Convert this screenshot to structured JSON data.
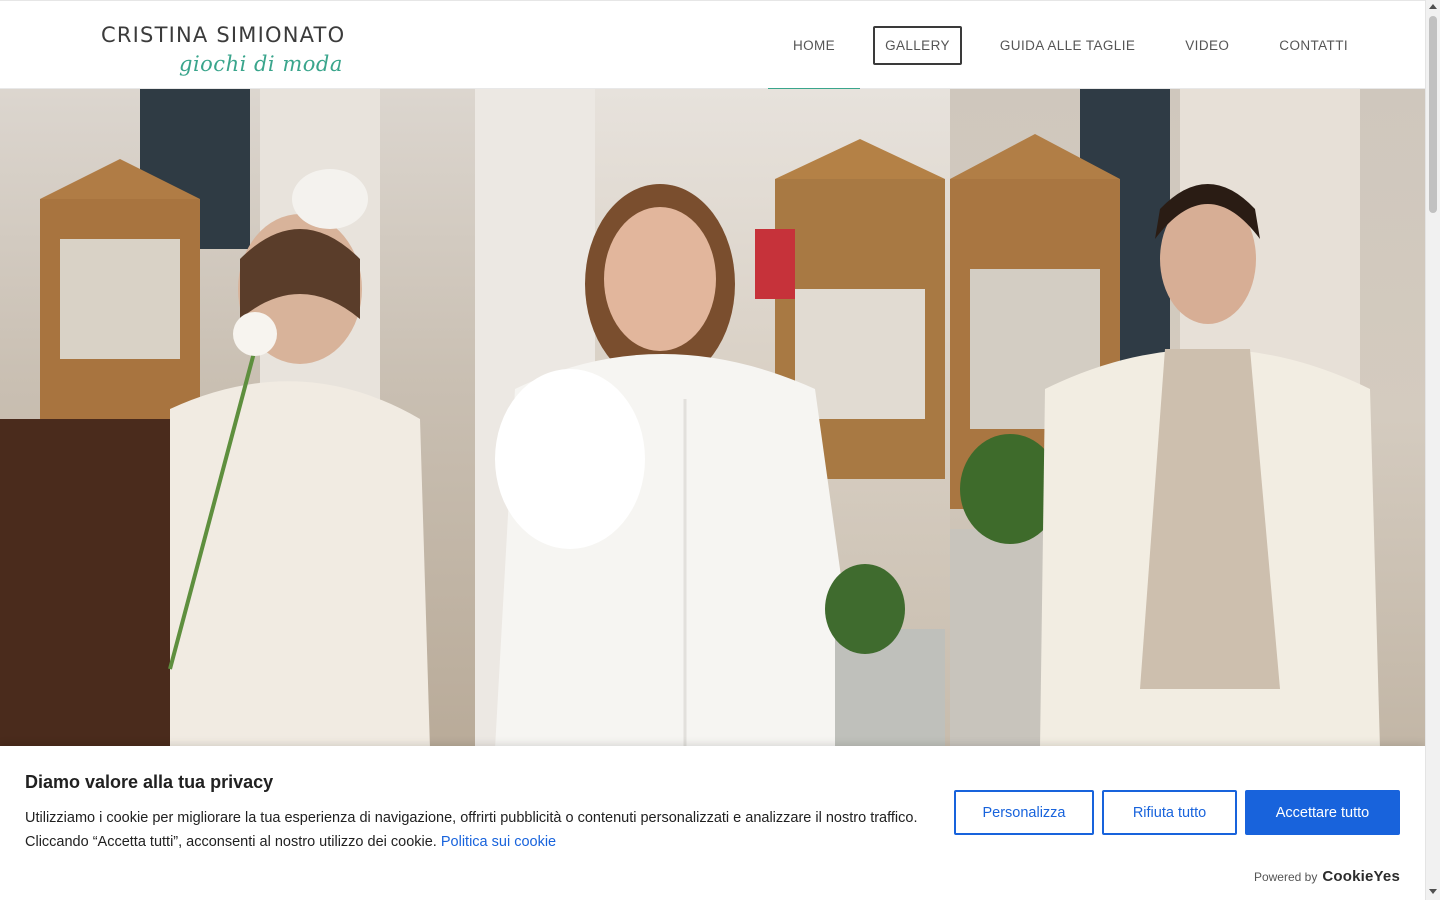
{
  "header": {
    "logo_main": "CRISTINA SIMIONATO",
    "logo_sub": "giochi di moda",
    "nav": [
      {
        "label": "HOME"
      },
      {
        "label": "GALLERY"
      },
      {
        "label": "GUIDA ALLE TAGLIE"
      },
      {
        "label": "VIDEO"
      },
      {
        "label": "CONTATTI"
      }
    ],
    "active_item": "HOME",
    "focused_item": "GALLERY"
  },
  "colors": {
    "accent": "#3aa58c",
    "cookie_blue": "#1863dc",
    "text_dark": "#212121"
  },
  "hero": {
    "photos": [
      "photo-girl-with-rose",
      "photo-woman-white-shirt",
      "photo-boy-cream-jacket"
    ]
  },
  "cookie_banner": {
    "title": "Diamo valore alla tua privacy",
    "text": "Utilizziamo i cookie per migliorare la tua esperienza di navigazione, offrirti pubblicità o contenuti personalizzati e analizzare il nostro traffico. Cliccando “Accetta tutti”, acconsenti al nostro utilizzo dei cookie.",
    "policy_link": "Politica sui cookie",
    "buttons": {
      "customize": "Personalizza",
      "reject": "Rifiuta tutto",
      "accept": "Accettare tutto"
    },
    "powered_by": "Powered by",
    "brand": "CookieYes"
  }
}
